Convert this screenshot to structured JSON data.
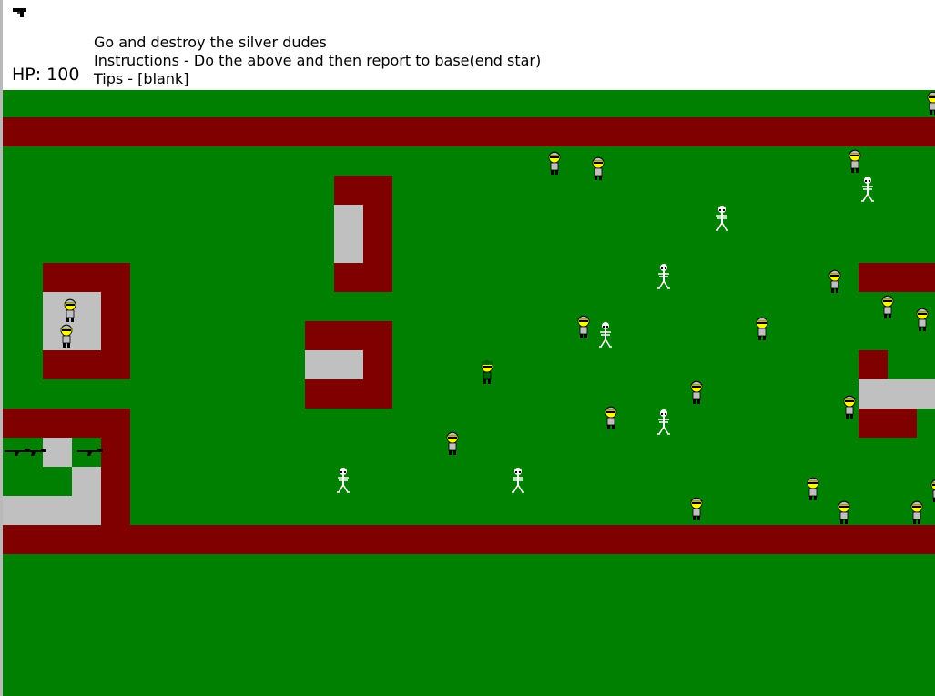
{
  "hud": {
    "weapon_icon": "pistol-icon",
    "hp_text": "HP: 100",
    "mission_lines": [
      "Go and destroy the silver dudes",
      "Instructions - Do the above and then report to base(end star)",
      "Tips - [blank]"
    ]
  },
  "colors": {
    "grass": "#008000",
    "wall": "#800000",
    "floor": "#c0c0c0",
    "enemy_face": "#ffff00",
    "enemy_body": "#c0c0c0",
    "player_body": "#006400",
    "skeleton": "#ffffff"
  },
  "map": {
    "entity_types": [
      "player-soldier",
      "silver-dude-enemy",
      "skeleton-enemy",
      "rifle-pickup"
    ]
  }
}
